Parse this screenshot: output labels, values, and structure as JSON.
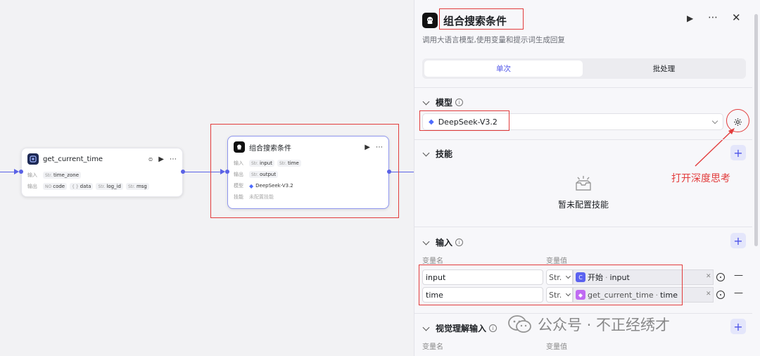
{
  "canvas": {
    "node_time": {
      "title": "get_current_time",
      "input_label": "输入",
      "inputs": [
        {
          "type": "Str.",
          "name": "time_zone"
        }
      ],
      "output_label": "输出",
      "outputs": [
        {
          "type": "NO",
          "name": "code"
        },
        {
          "type": "{ }",
          "name": "data"
        },
        {
          "type": "Str.",
          "name": "log_id"
        },
        {
          "type": "Str.",
          "name": "msg"
        }
      ]
    },
    "node_llm": {
      "title": "组合搜索条件",
      "input_label": "输入",
      "inputs": [
        {
          "type": "Str.",
          "name": "input"
        },
        {
          "type": "Str.",
          "name": "time"
        }
      ],
      "output_label": "输出",
      "outputs": [
        {
          "type": "Str.",
          "name": "output"
        }
      ],
      "model_label": "模型",
      "model_value": "DeepSeek-V3.2",
      "skill_label": "技能",
      "skill_value": "未配置技能"
    },
    "edge_color": "#5a62e6"
  },
  "panel": {
    "title": "组合搜索条件",
    "description": "调用大语言模型,使用变量和提示词生成回复",
    "tabs": [
      {
        "label": "单次",
        "active": true
      },
      {
        "label": "批处理",
        "active": false
      }
    ],
    "model_section": {
      "title": "模型",
      "selected": "DeepSeek-V3.2"
    },
    "skills_section": {
      "title": "技能",
      "empty_text": "暂未配置技能"
    },
    "annotation": "打开深度思考",
    "input_section": {
      "title": "输入",
      "col_name": "变量名",
      "col_value": "变量值",
      "rows": [
        {
          "name": "input",
          "type": "Str.",
          "ref_source": "开始",
          "ref_var": "input"
        },
        {
          "name": "time",
          "type": "Str.",
          "ref_source": "get_current_time",
          "ref_var": "time"
        }
      ]
    },
    "vision_section": {
      "title": "视觉理解输入",
      "col_name": "变量名",
      "col_value": "变量值"
    }
  },
  "watermark": "公众号 · 不正经绣才",
  "accent": "#4d53e8",
  "annotation_color": "#e23c3c"
}
